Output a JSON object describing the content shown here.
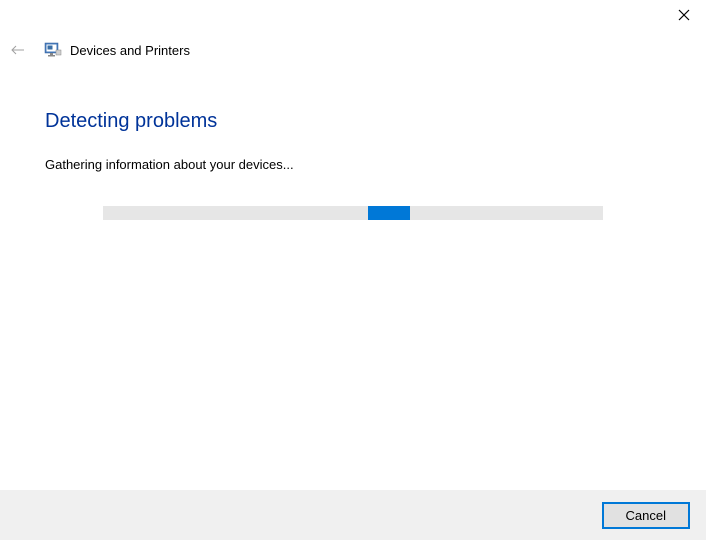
{
  "window": {
    "title": "Devices and Printers"
  },
  "content": {
    "heading": "Detecting problems",
    "status": "Gathering information about your devices..."
  },
  "footer": {
    "cancel_label": "Cancel"
  },
  "colors": {
    "heading": "#003399",
    "progress": "#0078d7",
    "footer_bg": "#f0f0f0"
  }
}
